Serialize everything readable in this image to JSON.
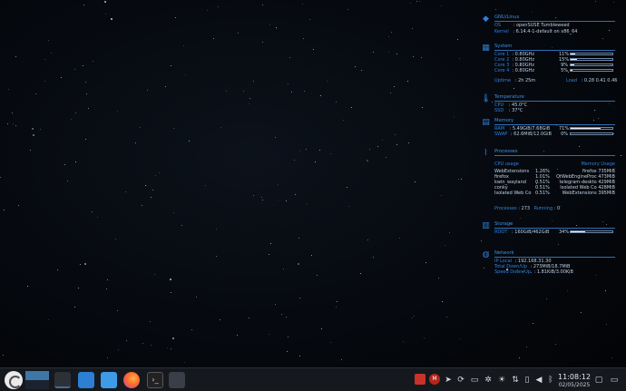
{
  "system": {
    "title": "GNU/Linux",
    "os_label": "OS",
    "os_value": ": openSUSE Tumbleweed",
    "kernel_label": "Kernel",
    "kernel_value": ": 6.14.4-1-default on x86_64"
  },
  "cpu": {
    "title": "System",
    "cores": [
      {
        "label": "Core 1",
        "freq": ": 0.80GHz",
        "pct": "11%",
        "fill": 11
      },
      {
        "label": "Core 2",
        "freq": ": 0.80GHz",
        "pct": "15%",
        "fill": 15
      },
      {
        "label": "Core 3",
        "freq": ": 0.80GHz",
        "pct": "9%",
        "fill": 9
      },
      {
        "label": "Core 4",
        "freq": ": 0.80GHz",
        "pct": "5%",
        "fill": 5
      }
    ],
    "uptime_label": "Uptime",
    "uptime_value": ": 2h 25m",
    "load_label": "Load",
    "load_value": ": 0.28 0.41 0.46"
  },
  "temperature": {
    "title": "Temperature",
    "cpu_label": "CPU",
    "cpu_value": ": 45.0°C",
    "ssd_label": "SSD",
    "ssd_value": ": 37°C"
  },
  "memory": {
    "title": "Memory",
    "ram_label": "RAM",
    "ram_value": ": 5.49GiB/7.68GiB",
    "ram_pct": "71%",
    "ram_fill": 71,
    "swap_label": "SWAP",
    "swap_value": ": 62.6MiB/12.0GiB",
    "swap_pct": "0%",
    "swap_fill": 0
  },
  "processes": {
    "title": "Processes",
    "cpu_header": "CPU usage",
    "mem_header": "Memory Usage",
    "cpu_list": [
      {
        "name": "WebExtensions",
        "value": "1.26%"
      },
      {
        "name": "firefox",
        "value": "1.01%"
      },
      {
        "name": "kwin_wayland",
        "value": "0.51%"
      },
      {
        "name": "conky",
        "value": "0.51%"
      },
      {
        "name": "Isolated Web Co",
        "value": "0.51%"
      }
    ],
    "mem_list": [
      {
        "name": "firefox",
        "value": "735MiB"
      },
      {
        "name": "QtWebEngineProc",
        "value": "473MiB"
      },
      {
        "name": "telegram-deskto",
        "value": "429MiB"
      },
      {
        "name": "Isolated Web Co",
        "value": "428MiB"
      },
      {
        "name": "WebExtensions",
        "value": "395MiB"
      }
    ],
    "summary_processes_label": "Processes",
    "summary_processes_value": ": 273",
    "summary_running_label": "Running",
    "summary_running_value": ": 0"
  },
  "storage": {
    "title": "Storage",
    "root_label": "ROOT",
    "root_value": ": 160GiB/462GiB",
    "root_pct": "34%",
    "root_fill": 34
  },
  "network": {
    "title": "Network",
    "ip_label": "IP Local",
    "ip_value": ": 192.168.31.30",
    "total_label": "Total Down/Up",
    "total_value": ": 273MiB/18.7MiB",
    "speed_label": "Speed Down/Up",
    "speed_value": ": 1.81KiB/3.00KiB"
  },
  "taskbar": {
    "time": "11:08:12",
    "date": "02/05/2025",
    "apps": [
      "terminal-icon",
      "discover-icon",
      "files-icon",
      "firefox-icon",
      "konsole-icon",
      "system-monitor-icon"
    ],
    "tray": [
      "red-app-icon",
      "mail-icon",
      "telegram-icon",
      "sync-icon",
      "clipboard-icon",
      "settings-icon",
      "brightness-icon",
      "network-icon",
      "device-icon",
      "battery-icon",
      "volume-icon",
      "bluetooth-icon",
      "wifi-icon",
      "expand-icon"
    ]
  },
  "colors": {
    "accent": "#2f82df",
    "panel": "#15191e"
  }
}
